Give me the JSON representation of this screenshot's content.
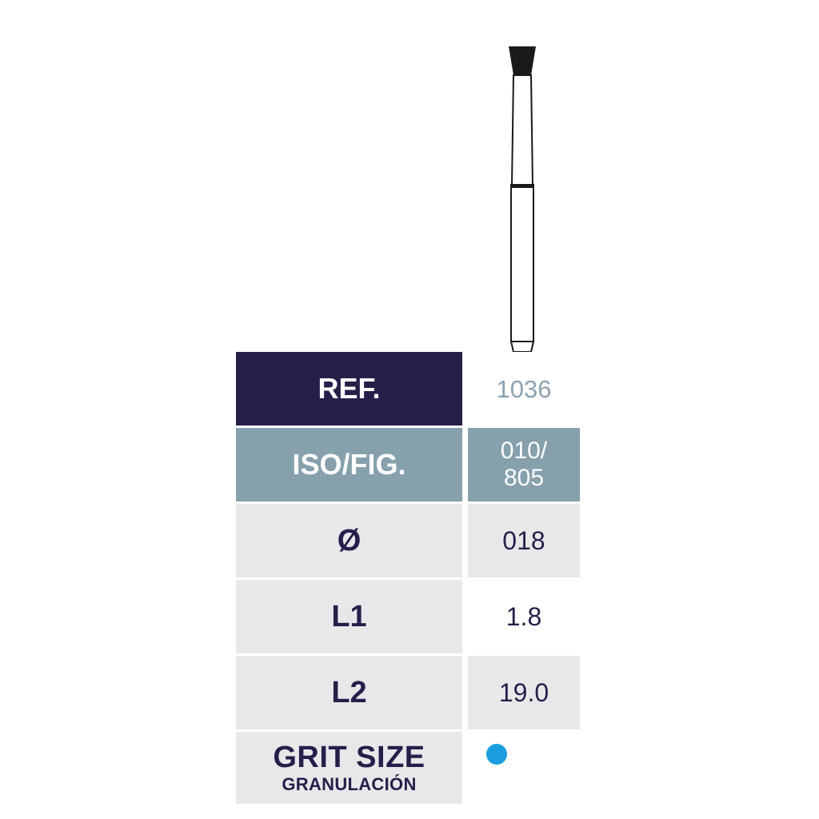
{
  "table": {
    "ref_label": "REF.",
    "ref_value": "1036",
    "iso_label": "ISO/FIG.",
    "iso_value_line1": "010/",
    "iso_value_line2": "805",
    "diameter_label": "Ø",
    "diameter_value": "018",
    "l1_label": "L1",
    "l1_value": "1.8",
    "l2_label": "L2",
    "l2_value": "19.0",
    "grit_label": "GRIT SIZE",
    "grit_sublabel": "GRANULACIÓN"
  },
  "grit_indicator": {
    "color": "#1b9ee0",
    "icon": "blue-grit-dot-icon"
  },
  "colors": {
    "navy": "#261f4a",
    "steel_blue": "#86a0ac",
    "light_grey": "#e8e8ea",
    "ref_value_text": "#8aa2b2",
    "bur_head": "#1a1a1a"
  },
  "illustration": {
    "icon": "inverted-cone-bur-icon"
  }
}
